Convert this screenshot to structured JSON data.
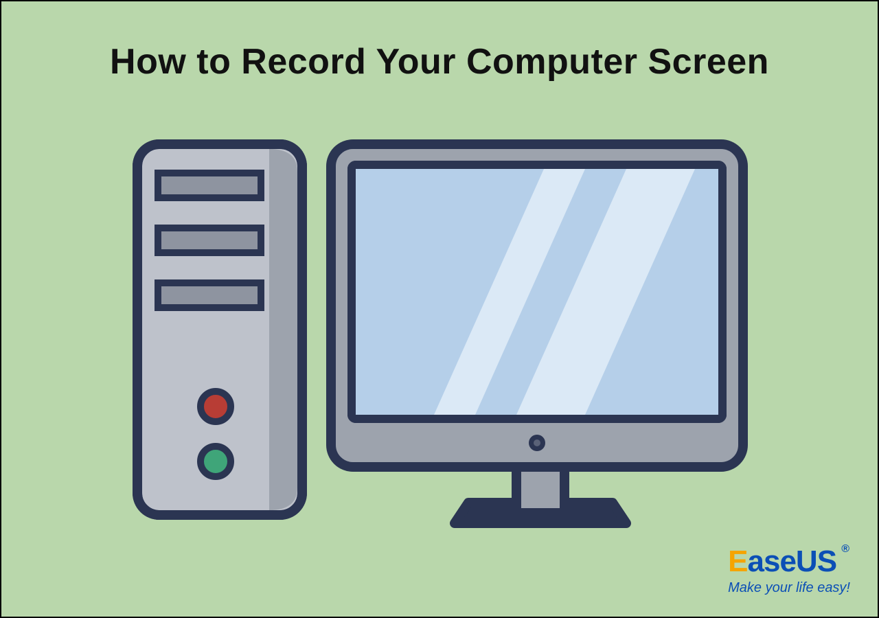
{
  "title": "How to Record Your Computer Screen",
  "brand": {
    "part1": "E",
    "part2": "ase",
    "part3": "US",
    "registered": "®"
  },
  "tagline": "Make your life easy!",
  "illustration": {
    "name": "desktop-computer",
    "colors": {
      "outline": "#2b3552",
      "case_fill": "#bfc3cb",
      "case_dark": "#9da3ad",
      "slot_fill": "#8e94a0",
      "screen_fill": "#b5cfe9",
      "screen_glare": "#dbe9f6",
      "bezel": "#9da3ad",
      "red_btn": "#b83d35",
      "green_btn": "#3fa579",
      "stand": "#2b3552"
    }
  }
}
